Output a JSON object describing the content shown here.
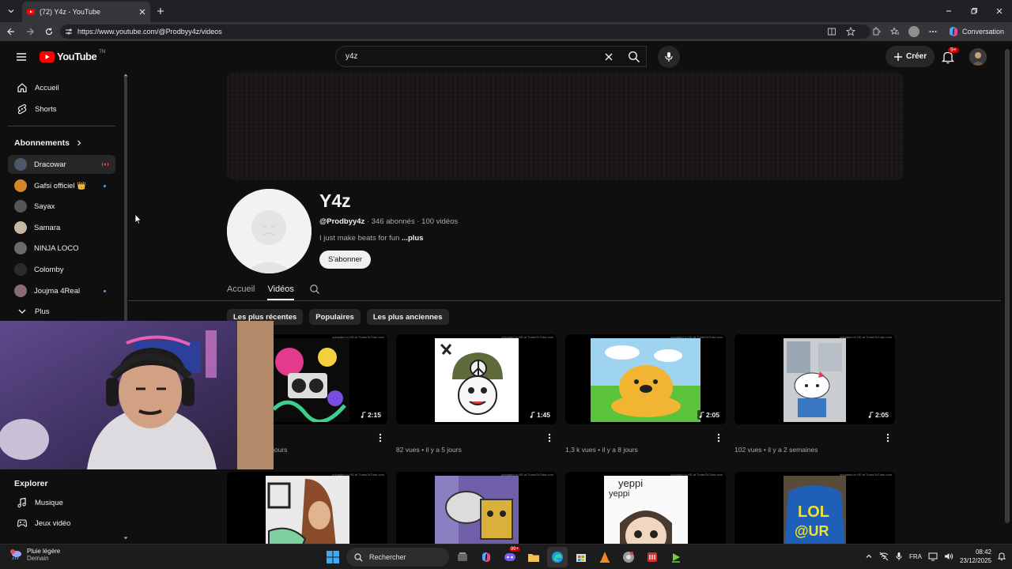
{
  "browser": {
    "tab_title": "(72) Y4z - YouTube",
    "url": "https://www.youtube.com/@Prodbyy4z/videos",
    "conversation_label": "Conversation"
  },
  "header": {
    "logo_text": "YouTube",
    "country_code": "TN",
    "search_value": "y4z",
    "create_label": "Créer",
    "notification_count": "9+"
  },
  "sidebar": {
    "main_items": [
      {
        "label": "Accueil",
        "icon": "home-icon"
      },
      {
        "label": "Shorts",
        "icon": "shorts-icon"
      }
    ],
    "subscriptions_heading": "Abonnements",
    "subscriptions": [
      {
        "label": "Dracowar",
        "avatar_color": "#4a5a6a",
        "status": "live"
      },
      {
        "label": "Gafsi officiel 👑",
        "avatar_color": "#d4862a",
        "status": "new"
      },
      {
        "label": "Sayax",
        "avatar_color": "#555555",
        "status": ""
      },
      {
        "label": "Samara",
        "avatar_color": "#c9b7a6",
        "status": ""
      },
      {
        "label": "NINJA LOCO",
        "avatar_color": "#6a6a6a",
        "status": ""
      },
      {
        "label": "Colomby",
        "avatar_color": "#2b2b2b",
        "status": ""
      },
      {
        "label": "Joujma 4Real",
        "avatar_color": "#8a6a7a",
        "status": "new"
      }
    ],
    "more_label": "Plus",
    "explore_heading": "Explorer",
    "explore_items": [
      {
        "label": "Musique",
        "icon": "music-icon"
      },
      {
        "label": "Jeux vidéo",
        "icon": "gaming-icon"
      }
    ]
  },
  "channel": {
    "name": "Y4z",
    "handle": "@Prodbyy4z",
    "subscribers": "346 abonnés",
    "video_count": "100 vidéos",
    "description": "I just make beats for fun",
    "more": "...plus",
    "subscribe_label": "S'abonner",
    "tabs": [
      "Accueil",
      "Vidéos"
    ],
    "active_tab": "Vidéos",
    "chips": [
      "Les plus récentes",
      "Populaires",
      "Les plus anciennes"
    ]
  },
  "videos": [
    {
      "duration": "2:15",
      "meta": "jours"
    },
    {
      "duration": "1:45",
      "meta": "82 vues • il y a 5 jours"
    },
    {
      "duration": "2:05",
      "meta": "1,3 k vues • il y a 8 jours"
    },
    {
      "duration": "2:05",
      "meta": "102 vues • il y a 2 semaines"
    },
    {
      "duration": "",
      "meta": ""
    },
    {
      "duration": "",
      "meta": ""
    },
    {
      "duration": "",
      "meta": ""
    },
    {
      "duration": "",
      "meta": ""
    }
  ],
  "thumb_watermark": "uploaded in HD at TunesToTube.com",
  "thumb_texts": {
    "yeppi_a": "yeppi",
    "yeppi_b": "yeppi",
    "lol": "LOL",
    "ur": "@UR"
  },
  "taskbar": {
    "weather_line1": "Pluie légère",
    "weather_line2": "Demain",
    "search_label": "Rechercher",
    "language": "FRA",
    "time": "08:42",
    "date": "23/12/2025",
    "chat_badge": "99+"
  },
  "colors": {
    "yt_red": "#ff0000",
    "accent_blue": "#3ea6ff",
    "background": "#0f0f0f"
  }
}
